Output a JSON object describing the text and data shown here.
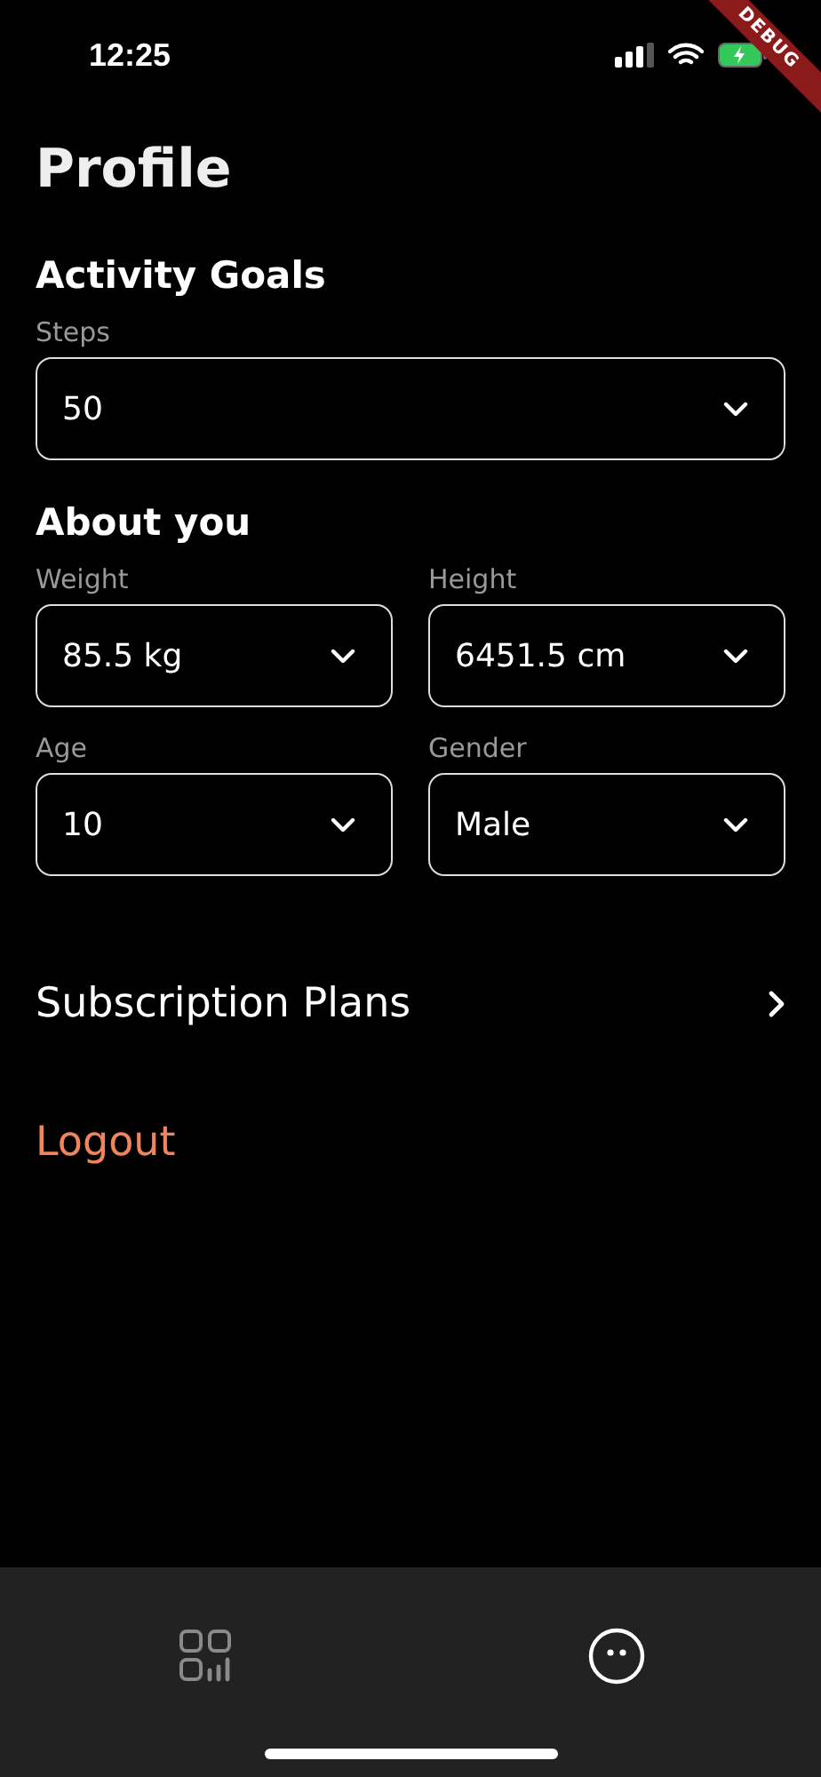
{
  "status_bar": {
    "time": "12:25"
  },
  "debug_banner": "DEBUG",
  "title": "Profile",
  "sections": [
    {
      "heading": "Activity Goals",
      "fields": [
        {
          "label": "Steps",
          "value": "50"
        }
      ]
    },
    {
      "heading": "About you",
      "fields": [
        {
          "label": "Weight",
          "value": "85.5 kg"
        },
        {
          "label": "Height",
          "value": "6451.5 cm"
        },
        {
          "label": "Age",
          "value": "10"
        },
        {
          "label": "Gender",
          "value": "Male"
        }
      ]
    }
  ],
  "links": [
    {
      "kind": "nav",
      "label": "Subscription Plans"
    },
    {
      "kind": "danger",
      "label": "Logout"
    }
  ],
  "tab_bar": [
    {
      "kind": "dashboard",
      "selected": false
    },
    {
      "kind": "profile",
      "selected": true
    }
  ]
}
